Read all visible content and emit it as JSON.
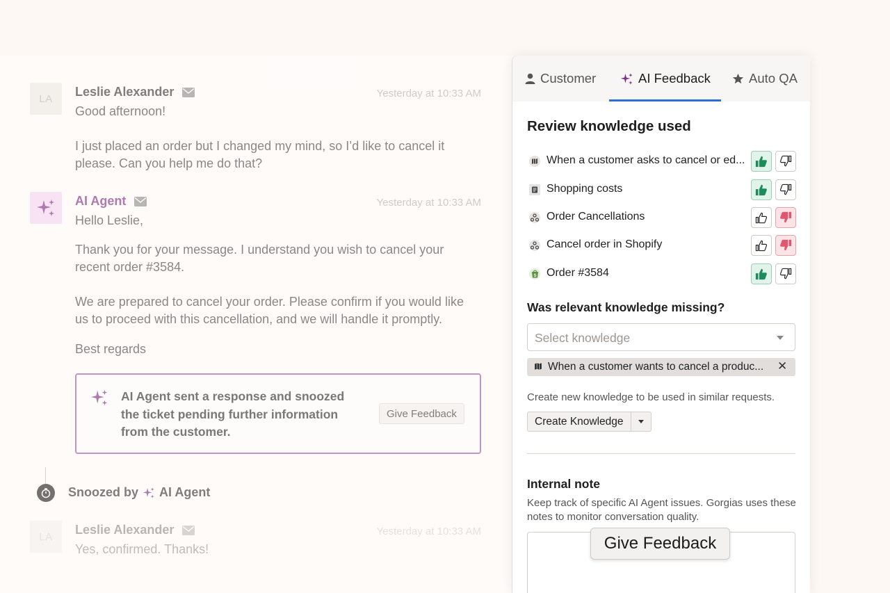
{
  "conversation": {
    "messages": [
      {
        "avatar": "LA",
        "sender": "Leslie Alexander",
        "time": "Yesterday at 10:33 AM",
        "paragraphs": [
          "Good afternoon!",
          "I just placed an order but I changed my mind, so I’d like to cancel it please. Can you help me do that?"
        ]
      },
      {
        "sender": "AI Agent",
        "time": "Yesterday at 10:33 AM",
        "paragraphs": [
          "Hello Leslie,",
          "Thank you for your message. I understand you wish to cancel your recent order #3584.",
          "We are prepared to cancel your order. Please confirm if you would like us to proceed with this cancellation, and we will handle it promptly.",
          "Best regards"
        ]
      },
      {
        "avatar": "LA",
        "sender": "Leslie Alexander",
        "time": "Yesterday at 10:33 AM",
        "paragraphs": [
          "Yes, confirmed. Thanks!"
        ]
      }
    ],
    "notice": {
      "text": "AI Agent sent a response and snoozed the ticket pending further information from the customer.",
      "button": "Give Feedback"
    },
    "snooze": {
      "prefix": "Snoozed by",
      "agent": "AI Agent"
    }
  },
  "panel": {
    "tabs": [
      {
        "label": "Customer",
        "icon": "person-icon",
        "active": false
      },
      {
        "label": "AI Feedback",
        "icon": "sparkle-icon",
        "active": true
      },
      {
        "label": "Auto QA",
        "icon": "star-icon",
        "active": false
      }
    ],
    "review_title": "Review knowledge used",
    "knowledge": [
      {
        "label": "When a customer asks to cancel or ed...",
        "icon": "guidance-icon",
        "rating": "up"
      },
      {
        "label": "Shopping costs",
        "icon": "article-icon",
        "rating": "up"
      },
      {
        "label": "Order Cancellations",
        "icon": "webhook-icon",
        "rating": "down"
      },
      {
        "label": "Cancel order in Shopify",
        "icon": "webhook-icon",
        "rating": "down"
      },
      {
        "label": "Order #3584",
        "icon": "shopify-icon",
        "rating": "up"
      }
    ],
    "missing_title": "Was relevant knowledge missing?",
    "select_placeholder": "Select knowledge",
    "selected_chip": "When a customer wants to cancel a produc...",
    "hint": "Create new knowledge to be used in similar requests.",
    "create_button": "Create Knowledge",
    "note_title": "Internal note",
    "note_desc": "Keep track of specific AI Agent issues. Gorgias uses these notes to monitor conversation quality.",
    "feedback_button": "Give Feedback"
  },
  "colors": {
    "accent_purple": "#9a5aa3",
    "tab_underline": "#2b6fd6",
    "thumb_up": "#1f8a5c",
    "thumb_down": "#e0566f"
  }
}
